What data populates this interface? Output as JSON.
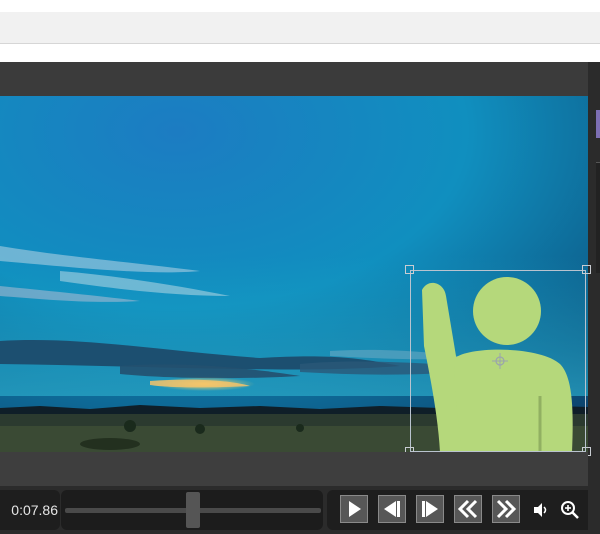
{
  "player": {
    "timecode": "0:07.86",
    "scrubber_progress": 0.5
  },
  "controls": {
    "buttons": [
      {
        "name": "play-button",
        "icon": "play-icon"
      },
      {
        "name": "previous-frame-button",
        "icon": "previous-frame-icon"
      },
      {
        "name": "next-frame-button",
        "icon": "next-frame-icon"
      },
      {
        "name": "rewind-button",
        "icon": "double-chevron-left-icon"
      },
      {
        "name": "fast-forward-button",
        "icon": "double-chevron-right-icon"
      }
    ],
    "volume_icon": "volume-icon",
    "zoom_icon": "zoom-in-icon"
  },
  "overlay": {
    "sticker": "waving-person-figure",
    "sticker_color": "#b5d87b"
  },
  "colors": {
    "editor_bg": "#3e3e3e",
    "controls_bg": "#2b2b2b",
    "accent": "#7d6fb3"
  }
}
